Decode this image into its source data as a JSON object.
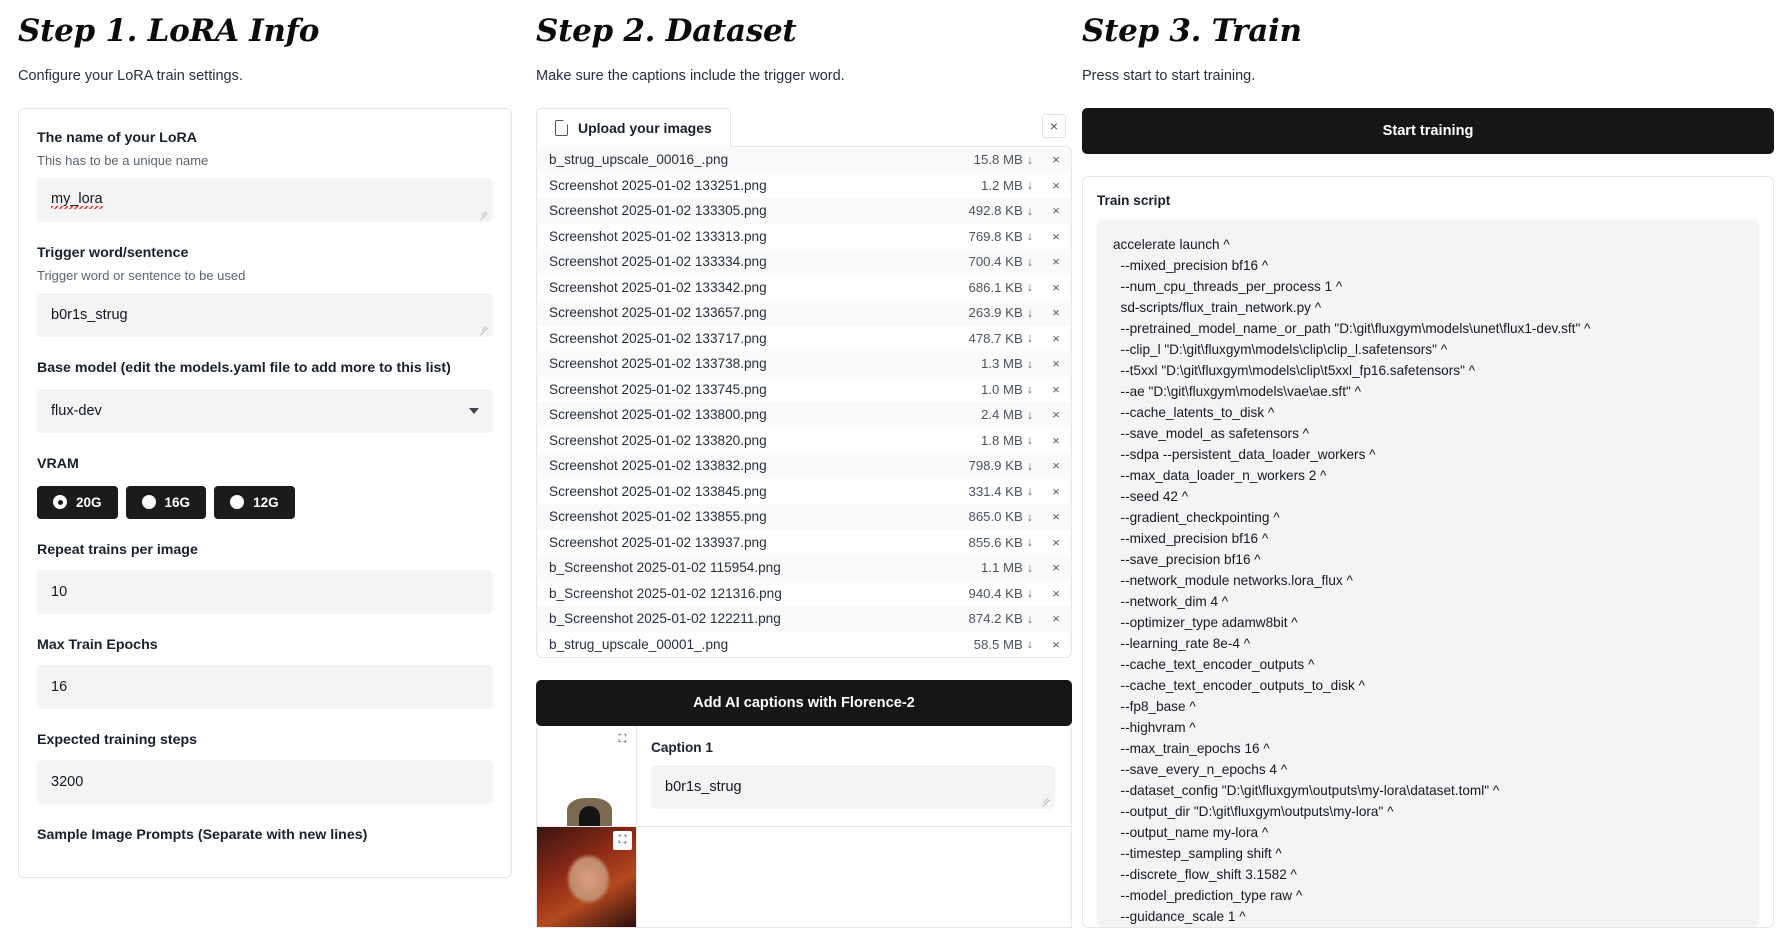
{
  "step1": {
    "title": "Step 1. LoRA Info",
    "subtitle": "Configure your LoRA train settings.",
    "name_label": "The name of your LoRA",
    "name_info": "This has to be a unique name",
    "name_value": "my_lora",
    "trigger_label": "Trigger word/sentence",
    "trigger_info": "Trigger word or sentence to be used",
    "trigger_value": "b0r1s_strug",
    "base_model_label": "Base model (edit the models.yaml file to add more to this list)",
    "base_model_value": "flux-dev",
    "vram_label": "VRAM",
    "vram_options": [
      {
        "label": "20G",
        "selected": true
      },
      {
        "label": "16G",
        "selected": false
      },
      {
        "label": "12G",
        "selected": false
      }
    ],
    "repeat_label": "Repeat trains per image",
    "repeat_value": "10",
    "epochs_label": "Max Train Epochs",
    "epochs_value": "16",
    "steps_label": "Expected training steps",
    "steps_value": "3200",
    "sample_label": "Sample Image Prompts (Separate with new lines)"
  },
  "step2": {
    "title": "Step 2. Dataset",
    "subtitle": "Make sure the captions include the trigger word.",
    "upload_label": "Upload your images",
    "upload_icon": "file-icon",
    "close_icon": "×",
    "download_icon": "↓",
    "remove_icon": "×",
    "files": [
      {
        "name": "b_strug_upscale_00016_.png",
        "size": "15.8 MB"
      },
      {
        "name": "Screenshot 2025-01-02 133251.png",
        "size": "1.2 MB"
      },
      {
        "name": "Screenshot 2025-01-02 133305.png",
        "size": "492.8 KB"
      },
      {
        "name": "Screenshot 2025-01-02 133313.png",
        "size": "769.8 KB"
      },
      {
        "name": "Screenshot 2025-01-02 133334.png",
        "size": "700.4 KB"
      },
      {
        "name": "Screenshot 2025-01-02 133342.png",
        "size": "686.1 KB"
      },
      {
        "name": "Screenshot 2025-01-02 133657.png",
        "size": "263.9 KB"
      },
      {
        "name": "Screenshot 2025-01-02 133717.png",
        "size": "478.7 KB"
      },
      {
        "name": "Screenshot 2025-01-02 133738.png",
        "size": "1.3 MB"
      },
      {
        "name": "Screenshot 2025-01-02 133745.png",
        "size": "1.0 MB"
      },
      {
        "name": "Screenshot 2025-01-02 133800.png",
        "size": "2.4 MB"
      },
      {
        "name": "Screenshot 2025-01-02 133820.png",
        "size": "1.8 MB"
      },
      {
        "name": "Screenshot 2025-01-02 133832.png",
        "size": "798.9 KB"
      },
      {
        "name": "Screenshot 2025-01-02 133845.png",
        "size": "331.4 KB"
      },
      {
        "name": "Screenshot 2025-01-02 133855.png",
        "size": "865.0 KB"
      },
      {
        "name": "Screenshot 2025-01-02 133937.png",
        "size": "855.6 KB"
      },
      {
        "name": "b_Screenshot 2025-01-02 115954.png",
        "size": "1.1 MB"
      },
      {
        "name": "b_Screenshot 2025-01-02 121316.png",
        "size": "940.4 KB"
      },
      {
        "name": "b_Screenshot 2025-01-02 122211.png",
        "size": "874.2 KB"
      },
      {
        "name": "b_strug_upscale_00001_.png",
        "size": "58.5 MB"
      }
    ],
    "florence_button": "Add AI captions with Florence-2",
    "captions": [
      {
        "label": "Caption 1",
        "value": "b0r1s_strug"
      }
    ],
    "expand_icon": "⛶"
  },
  "step3": {
    "title": "Step 3. Train",
    "subtitle": "Press start to start training.",
    "start_button": "Start training",
    "train_script_label": "Train script",
    "train_script": "accelerate launch ^\n  --mixed_precision bf16 ^\n  --num_cpu_threads_per_process 1 ^\n  sd-scripts/flux_train_network.py ^\n  --pretrained_model_name_or_path \"D:\\git\\fluxgym\\models\\unet\\flux1-dev.sft\" ^\n  --clip_l \"D:\\git\\fluxgym\\models\\clip\\clip_l.safetensors\" ^\n  --t5xxl \"D:\\git\\fluxgym\\models\\clip\\t5xxl_fp16.safetensors\" ^\n  --ae \"D:\\git\\fluxgym\\models\\vae\\ae.sft\" ^\n  --cache_latents_to_disk ^\n  --save_model_as safetensors ^\n  --sdpa --persistent_data_loader_workers ^\n  --max_data_loader_n_workers 2 ^\n  --seed 42 ^\n  --gradient_checkpointing ^\n  --mixed_precision bf16 ^\n  --save_precision bf16 ^\n  --network_module networks.lora_flux ^\n  --network_dim 4 ^\n  --optimizer_type adamw8bit ^\n  --learning_rate 8e-4 ^\n  --cache_text_encoder_outputs ^\n  --cache_text_encoder_outputs_to_disk ^\n  --fp8_base ^\n  --highvram ^\n  --max_train_epochs 16 ^\n  --save_every_n_epochs 4 ^\n  --dataset_config \"D:\\git\\fluxgym\\outputs\\my-lora\\dataset.toml\" ^\n  --output_dir \"D:\\git\\fluxgym\\outputs\\my-lora\" ^\n  --output_name my-lora ^\n  --timestep_sampling shift ^\n  --discrete_flow_shift 3.1582 ^\n  --model_prediction_type raw ^\n  --guidance_scale 1 ^"
  },
  "colors": {
    "dark": "#161616",
    "field_bg": "#f4f4f5",
    "border": "#e6e6e6"
  }
}
